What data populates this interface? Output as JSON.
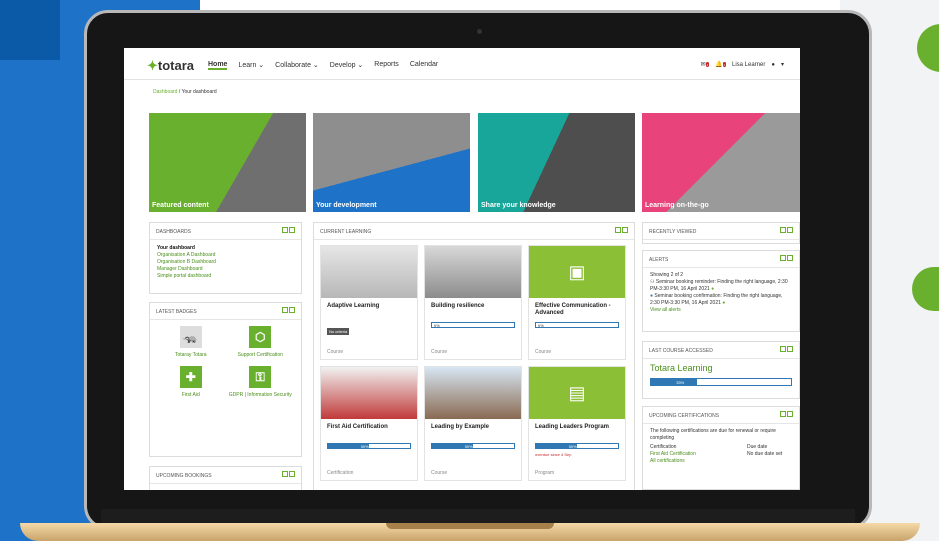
{
  "brand": {
    "logo_text": "totara"
  },
  "nav": {
    "items": [
      "Home",
      "Learn",
      "Collaborate",
      "Develop",
      "Reports",
      "Calendar"
    ],
    "user_name": "Lisa Learner"
  },
  "breadcrumb": {
    "root": "Dashboard",
    "separator": "/",
    "current": "Your dashboard"
  },
  "hero": [
    {
      "label": "Featured content",
      "color": "#69b02f"
    },
    {
      "label": "Your development",
      "color": "#1e73c8"
    },
    {
      "label": "Share your knowledge",
      "color": "#18a59a"
    },
    {
      "label": "Learning on-the-go",
      "color": "#e8437a"
    }
  ],
  "dashboards": {
    "title": "DASHBOARDS",
    "items": [
      "Your dashboard",
      "Organisation A Dashboard",
      "Organisation B Dashboard",
      "Manager Dashboard",
      "Simple portal dashboard"
    ]
  },
  "badges": {
    "title": "LATEST BADGES",
    "items": [
      "Totaray Totara",
      "Support Certification",
      "First Aid",
      "GDPR | Information Security"
    ]
  },
  "bookings": {
    "title": "UPCOMING BOOKINGS"
  },
  "learning": {
    "title": "CURRENT LEARNING",
    "courses": [
      {
        "title": "Adaptive Learning",
        "status": "No criteria",
        "type": "Course"
      },
      {
        "title": "Building resilience",
        "progress": 0,
        "progress_label": "0%",
        "type": "Course"
      },
      {
        "title": "Effective Communication - Advanced",
        "progress": 0,
        "progress_label": "0%",
        "type": "Course"
      },
      {
        "title": "First Aid Certification",
        "progress": 50,
        "progress_label": "50%",
        "type": "Certification"
      },
      {
        "title": "Leading by Example",
        "progress": 50,
        "progress_label": "50%",
        "type": "Course"
      },
      {
        "title": "Leading Leaders Program",
        "progress": 50,
        "progress_label": "50%",
        "overdue": "overdue since 4 Sep",
        "type": "Program"
      }
    ]
  },
  "recent": {
    "title": "RECENTLY VIEWED"
  },
  "alerts": {
    "title": "ALERTS",
    "count": "Showing 2 of 2",
    "items": [
      "Seminar booking reminder: Finding the right language, 2:30 PM-3:30 PM, 16 April 2021",
      "Seminar booking confirmation: Finding the right language, 2:30 PM-3:30 PM, 16 April 2021"
    ],
    "link": "View all alerts"
  },
  "last_course": {
    "title": "LAST COURSE ACCESSED",
    "name": "Totara Learning",
    "progress": 33,
    "progress_label": "33%"
  },
  "certs": {
    "title": "UPCOMING CERTIFICATIONS",
    "intro": "The following certifications are due for renewal or require completing",
    "col1": "Certification",
    "col2": "Due date",
    "name": "First Aid Certification",
    "due": "No due date set",
    "link": "All certifications"
  }
}
